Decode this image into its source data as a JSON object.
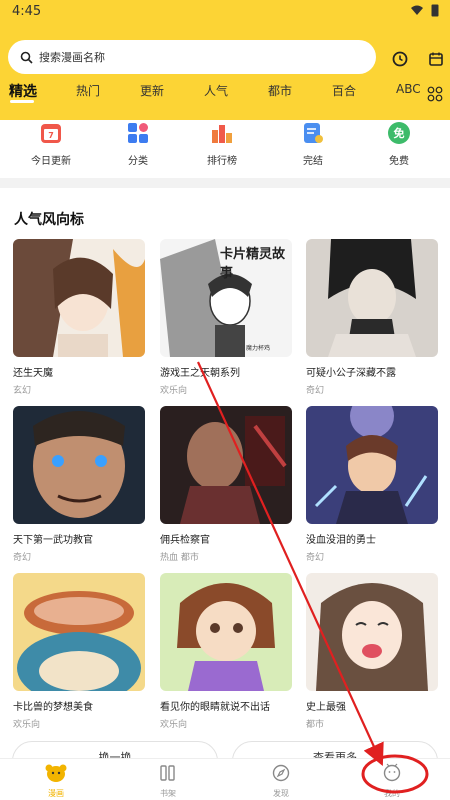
{
  "status": {
    "time": "4:45"
  },
  "search": {
    "placeholder": "搜索漫画名称"
  },
  "tabs": [
    "精选",
    "热门",
    "更新",
    "人气",
    "都市",
    "百合",
    "ABC"
  ],
  "quick": [
    {
      "label": "今日更新",
      "icon": "calendar-icon",
      "color": "#f0574a"
    },
    {
      "label": "分类",
      "icon": "grid-icon",
      "color": "#3d7cf0"
    },
    {
      "label": "排行榜",
      "icon": "ranking-icon",
      "color": "#f07a3d"
    },
    {
      "label": "完结",
      "icon": "checklist-icon",
      "color": "#4a8ef0"
    },
    {
      "label": "免费",
      "icon": "free-badge-icon",
      "color": "#3dbb6a",
      "glyph": "免"
    }
  ],
  "section": {
    "title": "人气风向标"
  },
  "comics": [
    {
      "title": "还生天魔",
      "genre": "玄幻"
    },
    {
      "title": "游戏王之天朝系列",
      "genre": "欢乐向",
      "cover_text": "卡片精灵故事",
      "cover_sub": "魔力杯鸡"
    },
    {
      "title": "可疑小公子深藏不露",
      "genre": "奇幻"
    },
    {
      "title": "天下第一武功教官",
      "genre": "奇幻"
    },
    {
      "title": "佣兵检察官",
      "genre": "热血  都市"
    },
    {
      "title": "没血没泪的勇士",
      "genre": "奇幻"
    },
    {
      "title": "卡比兽的梦想美食",
      "genre": "欢乐向"
    },
    {
      "title": "看见你的眼睛就说不出话",
      "genre": "欢乐向"
    },
    {
      "title": "史上最强",
      "genre": "都市"
    }
  ],
  "buttons": {
    "refresh": "换一换",
    "more": "查看更多"
  },
  "bottom_nav": [
    {
      "label": "漫画",
      "icon": "bear-icon",
      "active": true
    },
    {
      "label": "书架",
      "icon": "bookshelf-icon",
      "active": false
    },
    {
      "label": "发现",
      "icon": "compass-icon",
      "active": false
    },
    {
      "label": "我的",
      "icon": "profile-icon",
      "active": false
    }
  ],
  "colors": {
    "brand": "#fcd435",
    "annotation": "#e02020"
  }
}
